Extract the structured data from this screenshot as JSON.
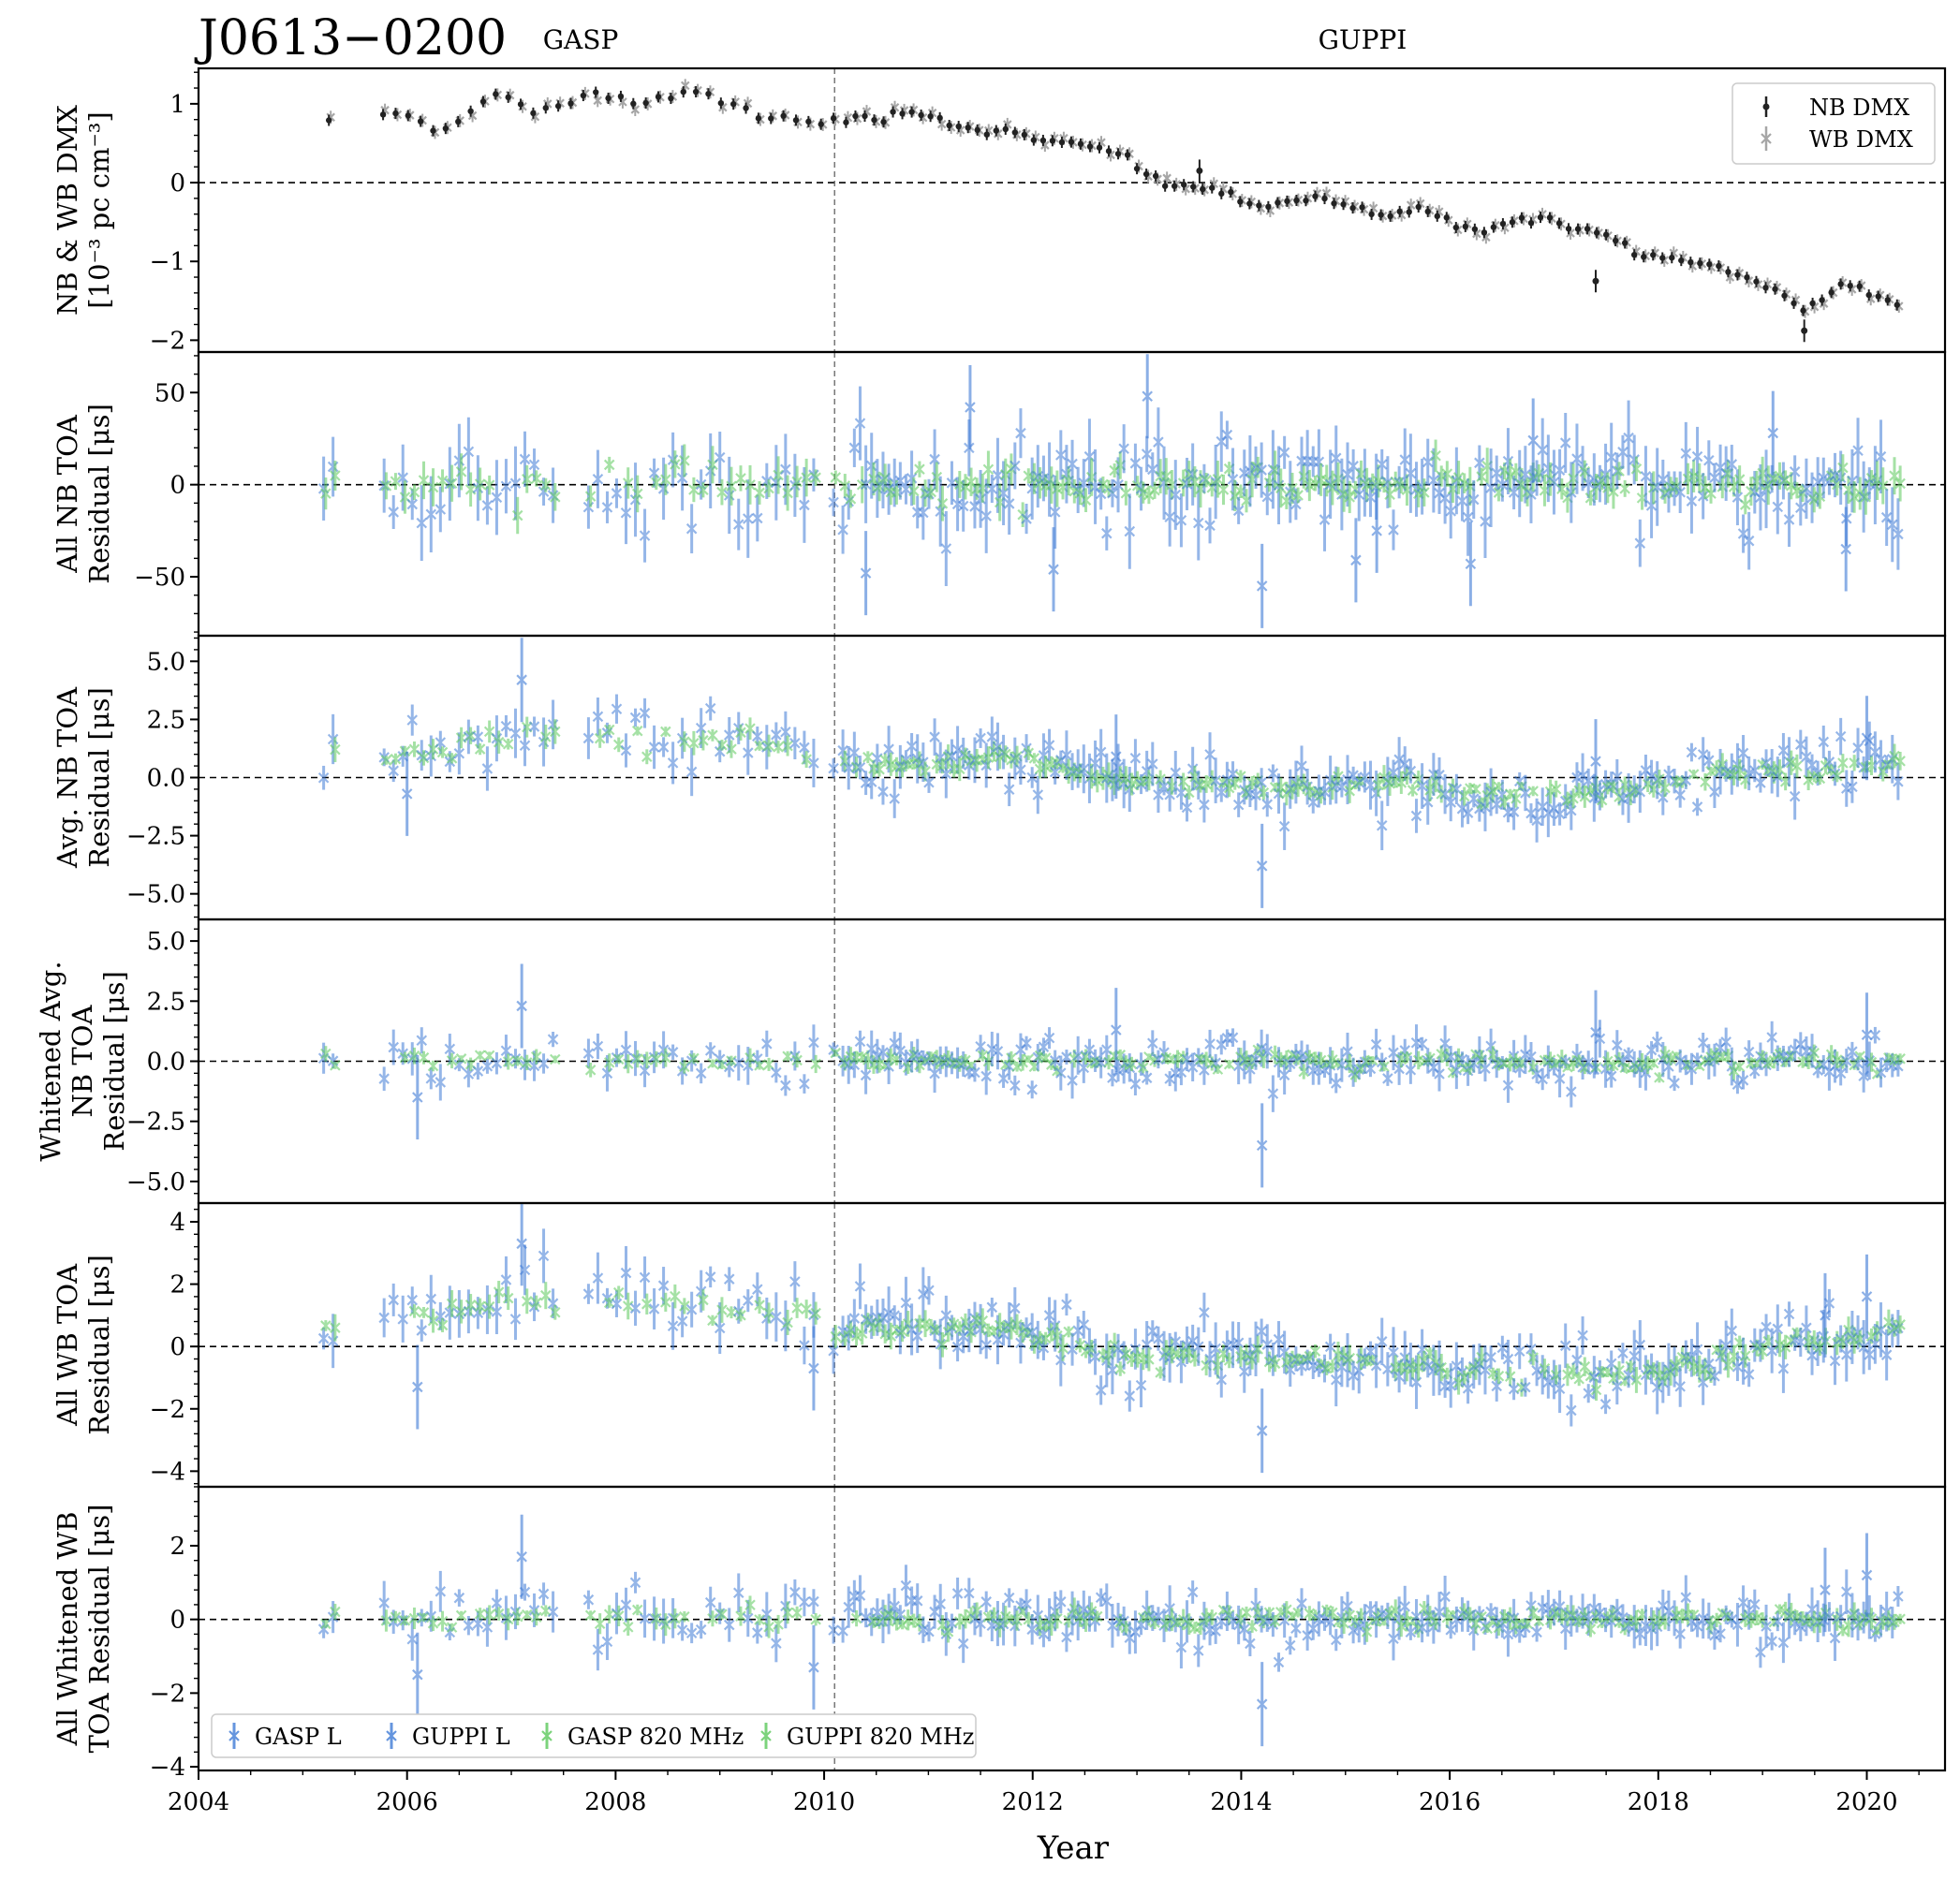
{
  "title": "J0613−0200",
  "backend_labels": [
    "GASP",
    "GUPPI"
  ],
  "colors": {
    "nb_dmx": "#222222",
    "wb_dmx": "#a6a6a6",
    "l_band": "#3f7bd6",
    "band_820": "#5cc95c",
    "frame": "#000000"
  },
  "chart_data": {
    "type": "scatter",
    "xlabel": "Year",
    "xlim": [
      2004,
      2020.75
    ],
    "xticks": [
      2004,
      2006,
      2008,
      2010,
      2012,
      2014,
      2016,
      2018,
      2020
    ],
    "backend_switch_year": 2010.1,
    "backend_label_years": [
      2007.65,
      2015.2
    ],
    "panels": [
      {
        "id": "dmx",
        "ylabel_lines": [
          "NB & WB DMX",
          "[10⁻³ pc cm⁻³]"
        ],
        "ylim": [
          -2.15,
          1.45
        ],
        "yticks": [
          1,
          0,
          -1,
          -2
        ],
        "ytick_labels": [
          "1",
          "0",
          "−1",
          "−2"
        ],
        "legend": {
          "position": "top-right",
          "items": [
            "NB DMX",
            "WB DMX"
          ]
        },
        "kind": "dmx",
        "trend": [
          [
            2005.25,
            0.8
          ],
          [
            2005.8,
            0.88
          ],
          [
            2006.0,
            0.85
          ],
          [
            2006.2,
            0.72
          ],
          [
            2006.4,
            0.72
          ],
          [
            2006.7,
            1.02
          ],
          [
            2006.9,
            1.12
          ],
          [
            2007.2,
            0.88
          ],
          [
            2007.5,
            0.95
          ],
          [
            2007.75,
            1.18
          ],
          [
            2008.2,
            1.0
          ],
          [
            2008.7,
            1.18
          ],
          [
            2009.0,
            1.05
          ],
          [
            2009.4,
            0.85
          ],
          [
            2009.9,
            0.8
          ],
          [
            2010.1,
            0.8
          ],
          [
            2010.5,
            0.8
          ],
          [
            2010.9,
            0.92
          ],
          [
            2011.2,
            0.75
          ],
          [
            2011.8,
            0.62
          ],
          [
            2012.3,
            0.48
          ],
          [
            2012.8,
            0.42
          ],
          [
            2013.0,
            0.2
          ],
          [
            2013.3,
            -0.05
          ],
          [
            2013.7,
            -0.05
          ],
          [
            2014.0,
            -0.25
          ],
          [
            2014.3,
            -0.3
          ],
          [
            2014.8,
            -0.2
          ],
          [
            2015.3,
            -0.4
          ],
          [
            2015.7,
            -0.32
          ],
          [
            2016.2,
            -0.62
          ],
          [
            2016.7,
            -0.45
          ],
          [
            2017.2,
            -0.55
          ],
          [
            2017.6,
            -0.75
          ],
          [
            2018.0,
            -0.98
          ],
          [
            2018.5,
            -1.05
          ],
          [
            2019.0,
            -1.3
          ],
          [
            2019.4,
            -1.6
          ],
          [
            2019.8,
            -1.28
          ],
          [
            2020.3,
            -1.55
          ]
        ]
      },
      {
        "id": "all_nb",
        "ylabel_lines": [
          "All NB TOA",
          "Residual [μs]"
        ],
        "ylim": [
          -82,
          72
        ],
        "yticks": [
          50,
          0,
          -50
        ],
        "ytick_labels": [
          "50",
          "0",
          "−50"
        ],
        "kind": "scatter",
        "scale": 12,
        "trend": [
          [
            2004.0,
            0
          ],
          [
            2020.5,
            0
          ]
        ]
      },
      {
        "id": "avg_nb",
        "ylabel_lines": [
          "Avg. NB TOA",
          "Residual [μs]"
        ],
        "ylim": [
          -6.1,
          6.1
        ],
        "yticks": [
          5.0,
          2.5,
          0.0,
          -2.5,
          -5.0
        ],
        "ytick_labels": [
          "5.0",
          "2.5",
          "0.0",
          "−2.5",
          "−5.0"
        ],
        "kind": "scatter",
        "scale": 0.6,
        "trend": [
          [
            2005.0,
            0.8
          ],
          [
            2006.0,
            1.0
          ],
          [
            2007.0,
            1.8
          ],
          [
            2008.0,
            2.0
          ],
          [
            2009.0,
            1.5
          ],
          [
            2009.9,
            1.0
          ],
          [
            2010.1,
            0.7
          ],
          [
            2010.5,
            0.4
          ],
          [
            2011.0,
            0.5
          ],
          [
            2011.7,
            0.8
          ],
          [
            2012.3,
            0.3
          ],
          [
            2013.0,
            -0.2
          ],
          [
            2013.8,
            -0.3
          ],
          [
            2014.5,
            -0.4
          ],
          [
            2015.5,
            -0.3
          ],
          [
            2016.5,
            -0.6
          ],
          [
            2017.3,
            -0.8
          ],
          [
            2018.0,
            -0.3
          ],
          [
            2019.0,
            0.2
          ],
          [
            2020.3,
            0.6
          ]
        ]
      },
      {
        "id": "whitened_avg_nb",
        "ylabel_lines": [
          "Whitened Avg.",
          "NB TOA",
          "Residual [μs]"
        ],
        "ylim": [
          -5.9,
          5.9
        ],
        "yticks": [
          5.0,
          2.5,
          0.0,
          -2.5,
          -5.0
        ],
        "ytick_labels": [
          "5.0",
          "2.5",
          "0.0",
          "−2.5",
          "−5.0"
        ],
        "kind": "scatter",
        "scale": 0.45,
        "trend": [
          [
            2004.0,
            0
          ],
          [
            2020.5,
            0
          ]
        ]
      },
      {
        "id": "all_wb",
        "ylabel_lines": [
          "All WB TOA",
          "Residual [μs]"
        ],
        "ylim": [
          -4.5,
          4.6
        ],
        "yticks": [
          4,
          2,
          0,
          -2,
          -4
        ],
        "ytick_labels": [
          "4",
          "2",
          "0",
          "−2",
          "−4"
        ],
        "kind": "scatter",
        "scale": 0.5,
        "trend": [
          [
            2005.0,
            0.6
          ],
          [
            2006.0,
            1.0
          ],
          [
            2007.0,
            1.5
          ],
          [
            2008.0,
            1.6
          ],
          [
            2009.0,
            1.2
          ],
          [
            2009.9,
            0.9
          ],
          [
            2010.1,
            0.6
          ],
          [
            2011.0,
            0.5
          ],
          [
            2011.7,
            0.7
          ],
          [
            2012.3,
            0.0
          ],
          [
            2013.0,
            -0.3
          ],
          [
            2014.0,
            -0.4
          ],
          [
            2015.0,
            -0.5
          ],
          [
            2016.0,
            -0.7
          ],
          [
            2017.0,
            -0.9
          ],
          [
            2017.5,
            -1.0
          ],
          [
            2018.3,
            -0.5
          ],
          [
            2019.0,
            -0.1
          ],
          [
            2019.5,
            0.3
          ],
          [
            2020.3,
            0.5
          ]
        ]
      },
      {
        "id": "whitened_wb",
        "ylabel_lines": [
          "All Whitened WB",
          "TOA Residual [μs]"
        ],
        "ylim": [
          -4.1,
          3.6
        ],
        "yticks": [
          2,
          0,
          -2,
          -4
        ],
        "ytick_labels": [
          "2",
          "0",
          "−2",
          "−4"
        ],
        "legend": {
          "position": "bottom-left",
          "items": [
            "GASP L",
            "GUPPI L",
            "GASP 820 MHz",
            "GUPPI 820 MHz"
          ]
        },
        "kind": "scatter",
        "scale": 0.35,
        "trend": [
          [
            2004.0,
            0
          ],
          [
            2020.5,
            0
          ]
        ]
      }
    ],
    "outliers": {
      "dmx": [
        [
          2017.4,
          -1.25
        ],
        [
          2019.4,
          -1.88
        ],
        [
          2013.6,
          0.15
        ]
      ],
      "all_nb": [
        [
          2010.4,
          -48
        ],
        [
          2012.2,
          -46
        ],
        [
          2013.1,
          48
        ],
        [
          2014.2,
          -55
        ],
        [
          2015.1,
          -41
        ],
        [
          2015.3,
          -25
        ],
        [
          2016.2,
          -43
        ],
        [
          2011.4,
          42
        ],
        [
          2019.8,
          -35
        ],
        [
          2016.8,
          24
        ],
        [
          2019.1,
          28
        ]
      ],
      "avg_nb": [
        [
          2007.1,
          4.2
        ],
        [
          2014.2,
          -3.8
        ],
        [
          2020.0,
          1.7
        ],
        [
          2017.4,
          0.7
        ],
        [
          2012.8,
          0.9
        ],
        [
          2006.0,
          -0.7
        ]
      ],
      "whitened_avg_nb": [
        [
          2007.1,
          2.3
        ],
        [
          2014.2,
          -3.5
        ],
        [
          2020.0,
          1.1
        ],
        [
          2017.4,
          1.2
        ],
        [
          2012.8,
          1.3
        ],
        [
          2006.1,
          -1.5
        ]
      ],
      "all_wb": [
        [
          2007.1,
          3.3
        ],
        [
          2014.2,
          -2.7
        ],
        [
          2020.0,
          1.6
        ],
        [
          2019.6,
          1.0
        ],
        [
          2009.9,
          -0.7
        ],
        [
          2006.1,
          -1.3
        ]
      ],
      "whitened_wb": [
        [
          2007.1,
          1.7
        ],
        [
          2014.2,
          -2.3
        ],
        [
          2020.0,
          1.2
        ],
        [
          2019.6,
          0.8
        ],
        [
          2009.9,
          -1.3
        ],
        [
          2006.1,
          -1.5
        ]
      ]
    }
  }
}
